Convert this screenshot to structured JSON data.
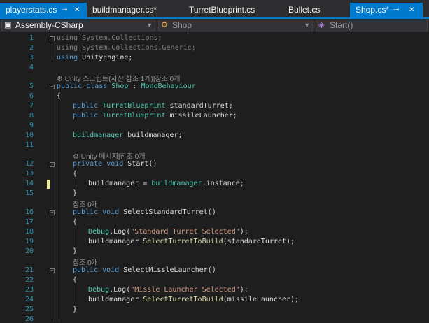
{
  "tabs": [
    {
      "label": "playerstats.cs",
      "active": true,
      "pinned": true
    },
    {
      "label": "buildmanager.cs*"
    },
    {
      "label": "TurretBlueprint.cs"
    },
    {
      "label": "Bullet.cs"
    },
    {
      "label": "Shop.cs*",
      "active": true,
      "pinned": true
    }
  ],
  "tab_buttons": {
    "pin": "⊸",
    "close": "✕"
  },
  "navbar": {
    "project": "Assembly-CSharp",
    "class": "Shop",
    "member": "Start()"
  },
  "line_numbers": [
    "1",
    "2",
    "3",
    "4",
    "5",
    "6",
    "7",
    "8",
    "9",
    "10",
    "11",
    "12",
    "13",
    "14",
    "15",
    "16",
    "17",
    "18",
    "19",
    "20",
    "21",
    "22",
    "23",
    "24",
    "25",
    "26"
  ],
  "codelens": {
    "unity_script": "⚙ Unity 스크립트(자산 참조 1개)|참조 0개",
    "unity_message": "⚙ Unity 메시지|참조 0개",
    "refs_zero": "참조 0개"
  },
  "code": {
    "l1": [
      "using",
      " System.Collections;"
    ],
    "l2": [
      "using",
      " System.Collections.Generic;"
    ],
    "l3": [
      "using",
      " UnityEngine;"
    ],
    "l5": [
      "public",
      " ",
      "class",
      " ",
      "Shop",
      " : ",
      "MonoBehaviour"
    ],
    "l6": "{",
    "l7": [
      "public",
      " ",
      "TurretBlueprint",
      " standardTurret;"
    ],
    "l8": [
      "public",
      " ",
      "TurretBlueprint",
      " missileLauncher;"
    ],
    "l10": [
      "buildmanager",
      " buildmanager;"
    ],
    "l12": [
      "private",
      " ",
      "void",
      " Start()"
    ],
    "l13": "{",
    "l14": [
      "buildmanager = ",
      "buildmanager",
      ".instance;"
    ],
    "l15": "}",
    "l16": [
      "public",
      " ",
      "void",
      " SelectStandardTurret()"
    ],
    "l17": "{",
    "l18": [
      "Debug",
      ".Log(",
      "\"Standard Turret Selected\"",
      ");"
    ],
    "l19": [
      "buildmanager.",
      "SelectTurretToBuild",
      "(standardTurret);"
    ],
    "l20": "}",
    "l21": [
      "public",
      " ",
      "void",
      " SelectMissleLauncher()"
    ],
    "l22": "{",
    "l23": [
      "Debug",
      ".Log(",
      "\"Missle Launcher Selected\"",
      ");"
    ],
    "l24": [
      "buildmanager.",
      "SelectTurretToBuild",
      "(missileLauncher);"
    ],
    "l25": "}"
  },
  "colors": {
    "accent": "#007acc",
    "keyword": "#569cd6",
    "type": "#4ec9b0",
    "string": "#d69d85",
    "line_number": "#2b91af",
    "modified": "#efef91"
  }
}
